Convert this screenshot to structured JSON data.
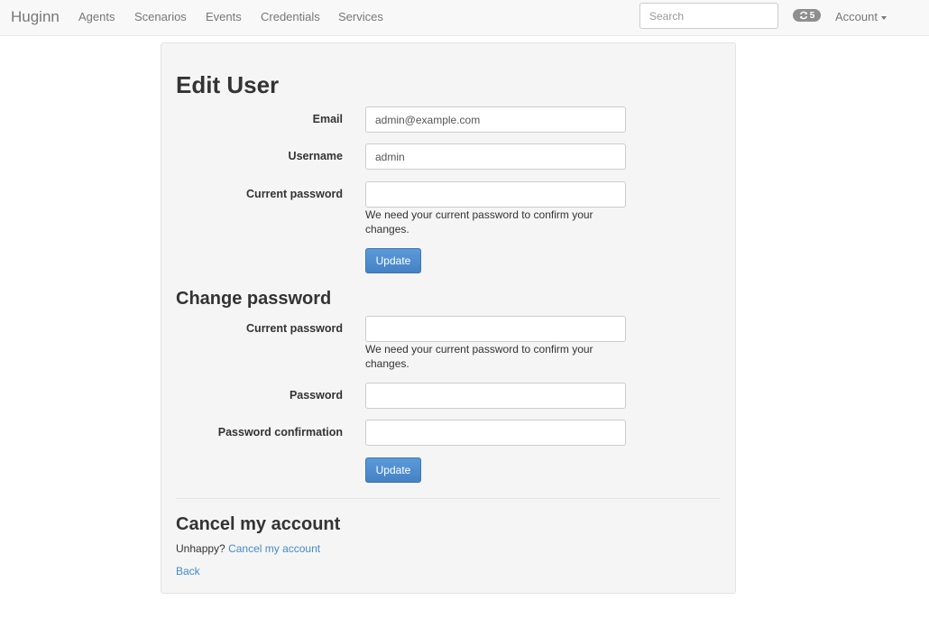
{
  "navbar": {
    "brand": "Huginn",
    "links": [
      "Agents",
      "Scenarios",
      "Events",
      "Credentials",
      "Services"
    ],
    "search_placeholder": "Search",
    "job_count": "5",
    "account_label": "Account"
  },
  "edit_user": {
    "title": "Edit User",
    "email_label": "Email",
    "email_value": "admin@example.com",
    "username_label": "Username",
    "username_value": "admin",
    "current_password_label": "Current password",
    "current_password_help": "We need your current password to confirm your changes.",
    "update_label": "Update"
  },
  "change_password": {
    "title": "Change password",
    "current_password_label": "Current password",
    "current_password_help": "We need your current password to confirm your changes.",
    "password_label": "Password",
    "confirmation_label": "Password confirmation",
    "update_label": "Update"
  },
  "cancel_account": {
    "title": "Cancel my account",
    "prompt": "Unhappy?",
    "link_label": "Cancel my account",
    "back_label": "Back"
  },
  "colors": {
    "link": "#428bca",
    "button": "#4d8cd0",
    "panel": "#f5f5f5",
    "navbar": "#f8f8f8"
  }
}
